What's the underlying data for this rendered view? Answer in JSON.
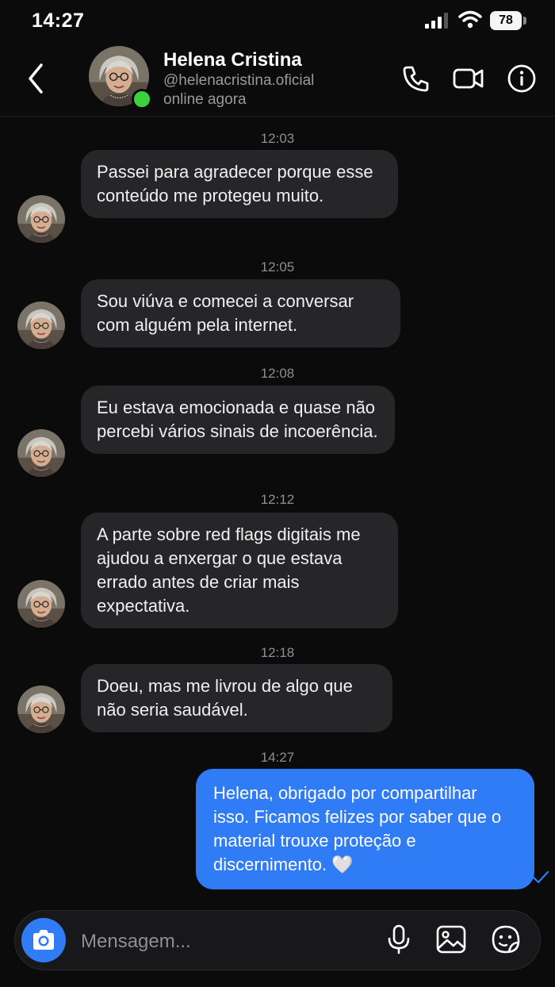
{
  "status_bar": {
    "time": "14:27",
    "battery": "78"
  },
  "header": {
    "name": "Helena Cristina",
    "handle": "@helenacristina.oficial",
    "status": "online agora"
  },
  "messages": [
    {
      "time": "12:03",
      "text": "Passei para agradecer porque esse conteúdo me protegeu muito."
    },
    {
      "time": "12:05",
      "text": "Sou viúva e comecei a conversar com alguém pela internet."
    },
    {
      "time": "12:08",
      "text": "Eu estava emocionada e quase não percebi vários sinais de incoerência."
    },
    {
      "time": "12:12",
      "text": "A parte sobre red flags digitais me ajudou a enxergar o que estava errado antes de criar mais expectativa."
    },
    {
      "time": "12:18",
      "text": "Doeu, mas me livrou de algo que não seria saudável."
    }
  ],
  "reply": {
    "time": "14:27",
    "text": "Helena, obrigado por compartilhar isso. Ficamos felizes por saber que o material trouxe proteção e discernimento. 🤍"
  },
  "composer": {
    "placeholder": "Mensagem..."
  },
  "icons": {
    "back": "chevron-left-icon",
    "call": "phone-icon",
    "video": "video-camera-icon",
    "info": "info-icon",
    "camera": "camera-icon",
    "mic": "microphone-icon",
    "gallery": "image-icon",
    "sticker": "sticker-icon",
    "read": "checkmark-icon"
  },
  "colors": {
    "accent": "#2f7cf6",
    "online": "#3bd13f",
    "bubble_in": "#262628",
    "background": "#0b0b0c"
  }
}
